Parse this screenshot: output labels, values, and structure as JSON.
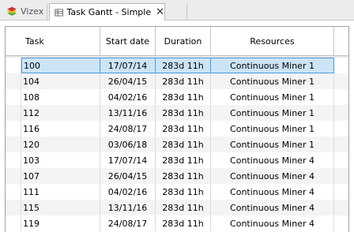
{
  "tabs": [
    {
      "label": "Vizex",
      "active": false,
      "icon": "layers-icon"
    },
    {
      "label": "Task Gantt - Simple",
      "active": true,
      "icon": "table-icon",
      "close": "✕"
    }
  ],
  "table": {
    "columns": [
      "Task",
      "Start date",
      "Duration",
      "Resources"
    ],
    "selected_row": 0,
    "rows": [
      {
        "task": "100",
        "start": "17/07/14",
        "duration": "283d 11h",
        "resource": "Continuous Miner 1"
      },
      {
        "task": "104",
        "start": "26/04/15",
        "duration": "283d 11h",
        "resource": "Continuous Miner 1"
      },
      {
        "task": "108",
        "start": "04/02/16",
        "duration": "283d 11h",
        "resource": "Continuous Miner 1"
      },
      {
        "task": "112",
        "start": "13/11/16",
        "duration": "283d 11h",
        "resource": "Continuous Miner 1"
      },
      {
        "task": "116",
        "start": "24/08/17",
        "duration": "283d 11h",
        "resource": "Continuous Miner 1"
      },
      {
        "task": "120",
        "start": "03/06/18",
        "duration": "283d 11h",
        "resource": "Continuous Miner 1"
      },
      {
        "task": "103",
        "start": "17/07/14",
        "duration": "283d 11h",
        "resource": "Continuous Miner 4"
      },
      {
        "task": "107",
        "start": "26/04/15",
        "duration": "283d 11h",
        "resource": "Continuous Miner 4"
      },
      {
        "task": "111",
        "start": "04/02/16",
        "duration": "283d 11h",
        "resource": "Continuous Miner 4"
      },
      {
        "task": "115",
        "start": "13/11/16",
        "duration": "283d 11h",
        "resource": "Continuous Miner 4"
      },
      {
        "task": "119",
        "start": "24/08/17",
        "duration": "283d 11h",
        "resource": "Continuous Miner 4"
      }
    ]
  },
  "colors": {
    "selection_fill": "#cce4f7",
    "selection_border": "#4a9ad8",
    "vizex_icon": "#6aa84f"
  }
}
